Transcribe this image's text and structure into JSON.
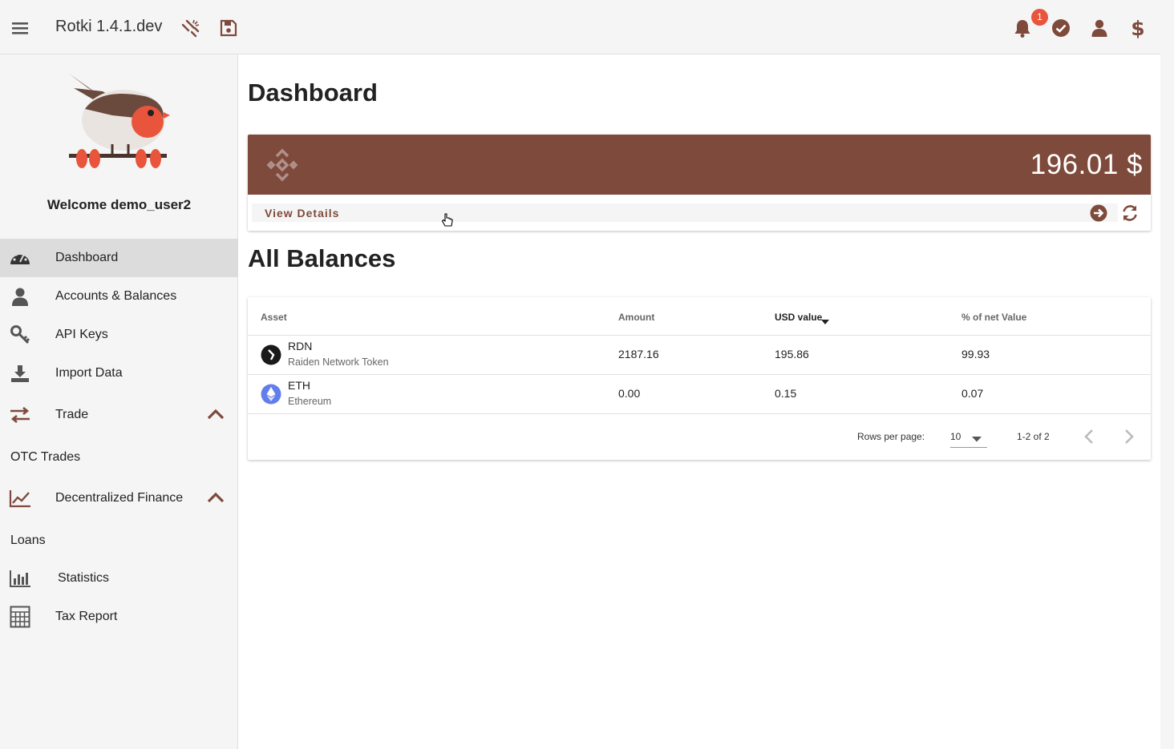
{
  "app": {
    "title": "Rotki 1.4.1.dev",
    "notification_count": "1"
  },
  "sidebar": {
    "welcome": "Welcome demo_user2",
    "items": [
      {
        "label": "Dashboard",
        "icon": "dashboard-icon"
      },
      {
        "label": "Accounts & Balances",
        "icon": "user-icon"
      },
      {
        "label": "API Keys",
        "icon": "key-icon"
      },
      {
        "label": "Import Data",
        "icon": "download-icon"
      },
      {
        "label": "Trade",
        "icon": "exchange-icon"
      },
      {
        "label": "OTC Trades"
      },
      {
        "label": "Decentralized Finance",
        "icon": "line-chart-icon"
      },
      {
        "label": "Loans"
      },
      {
        "label": "Statistics",
        "icon": "bar-chart-icon"
      },
      {
        "label": "Tax Report",
        "icon": "calculator-icon"
      }
    ]
  },
  "main": {
    "title": "Dashboard",
    "exchange_card": {
      "total": "196.01 $",
      "view_details": "View Details"
    },
    "balances_title": "All Balances",
    "table": {
      "headers": [
        "Asset",
        "Amount",
        "USD value",
        "% of net Value"
      ],
      "rows": [
        {
          "symbol": "RDN",
          "name": "Raiden Network Token",
          "amount": "2187.16",
          "usd": "195.86",
          "pct": "99.93"
        },
        {
          "symbol": "ETH",
          "name": "Ethereum",
          "amount": "0.00",
          "usd": "0.15",
          "pct": "0.07"
        }
      ],
      "rows_per_page_label": "Rows per page:",
      "rows_per_page": "10",
      "range": "1-2 of 2"
    }
  },
  "colors": {
    "brand": "#7e4a3b",
    "badge": "#e8553c",
    "eth": "#627eea"
  }
}
